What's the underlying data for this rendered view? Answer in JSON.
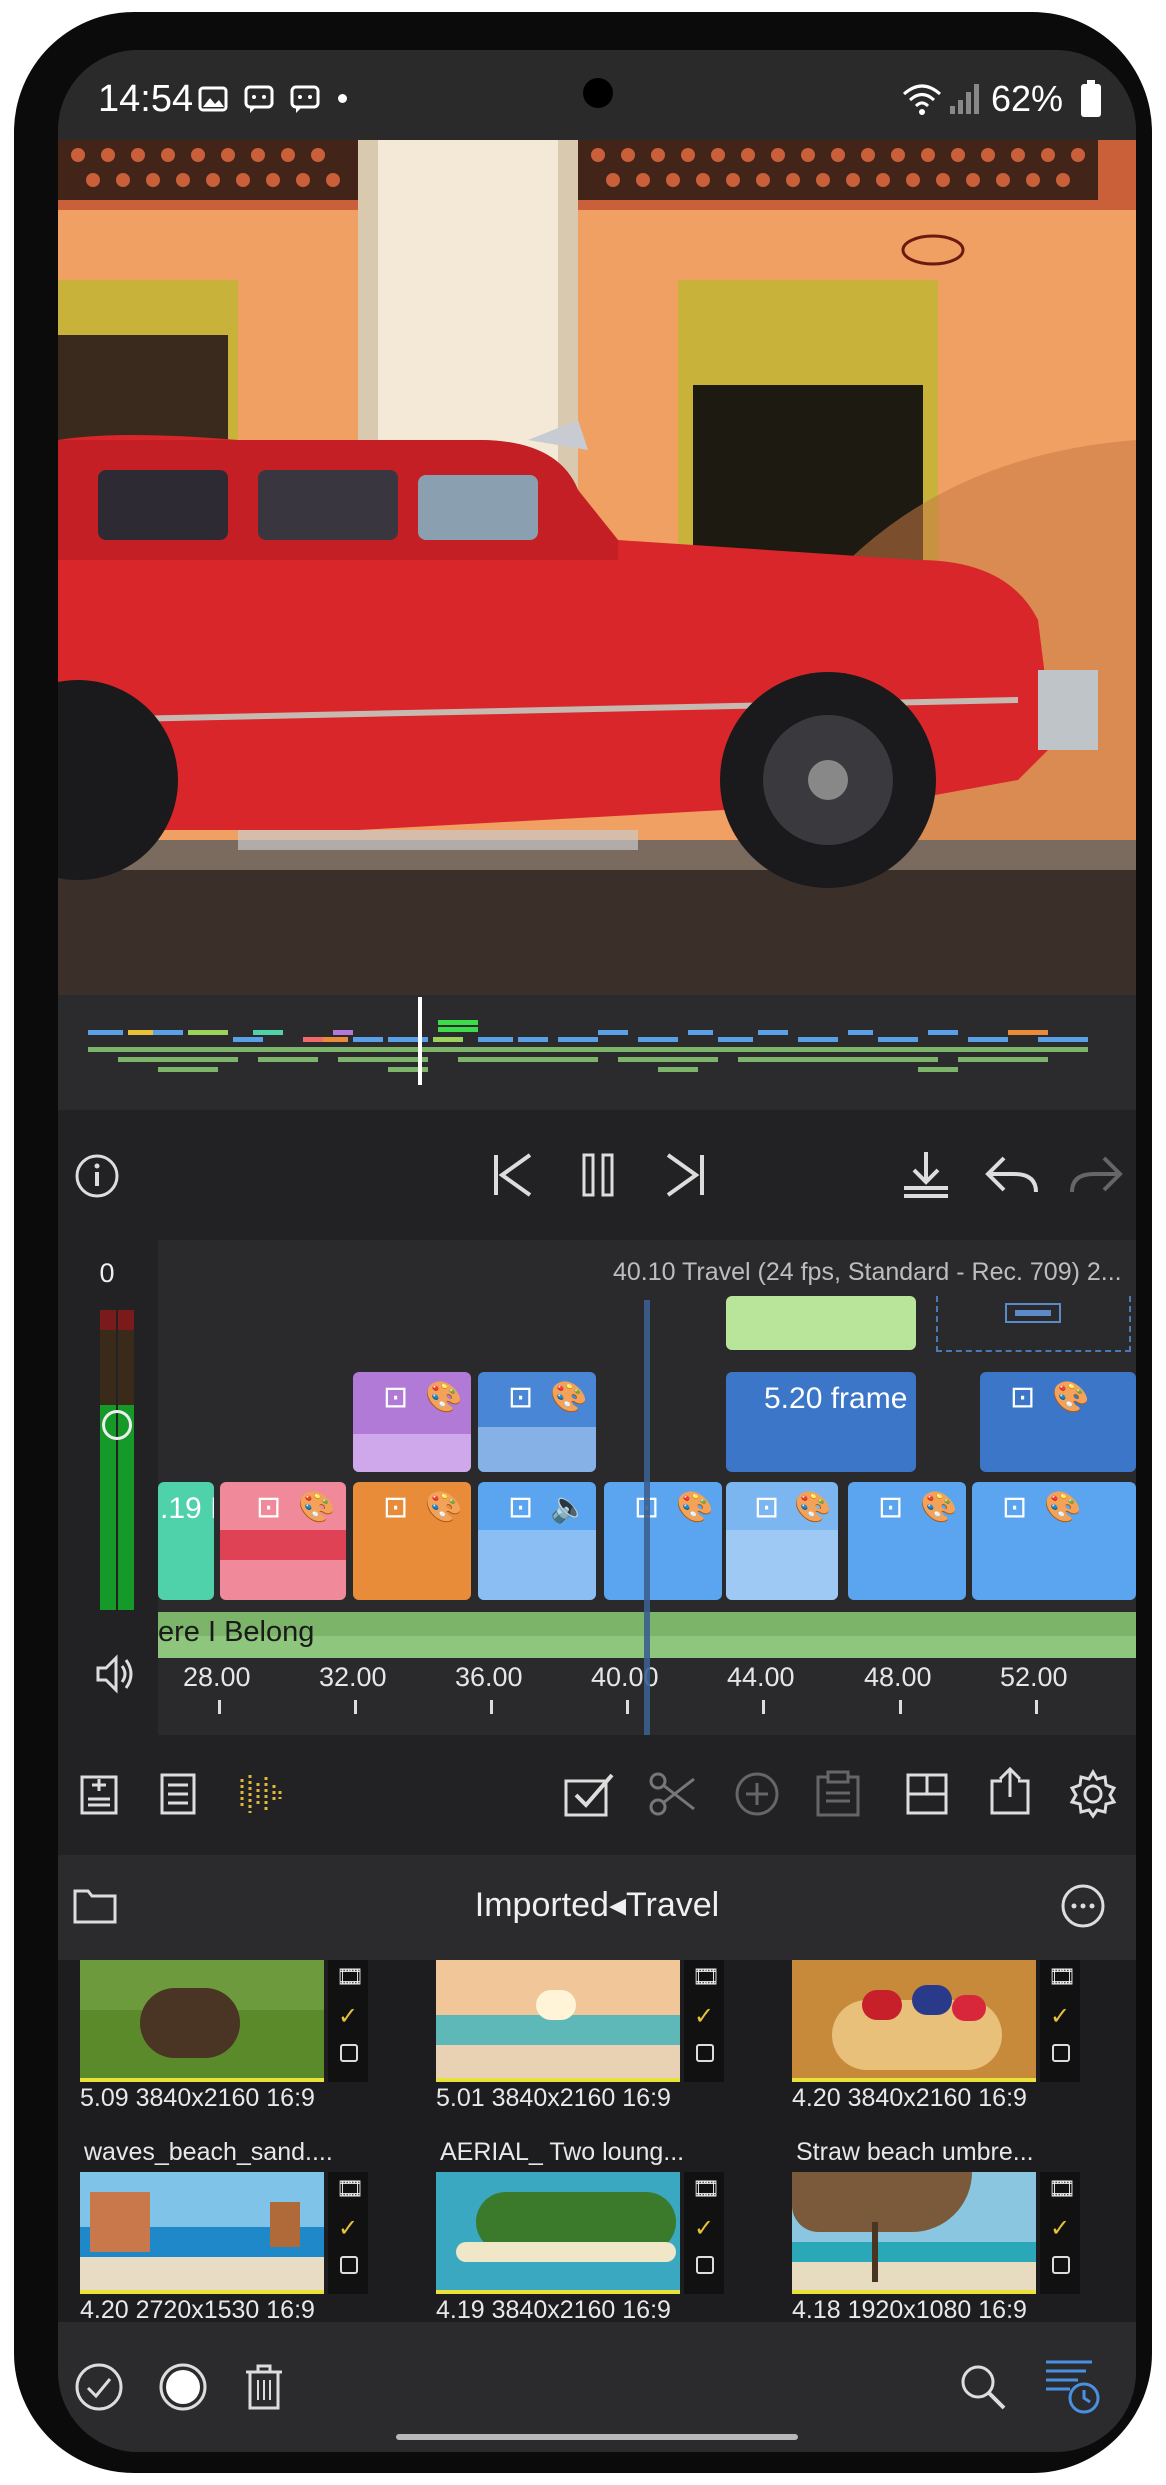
{
  "status": {
    "time": "14:54",
    "battery": "62%",
    "icons": [
      "image-icon",
      "message-icon",
      "message-icon",
      "dot-icon",
      "wifi-icon",
      "signal-icon",
      "battery-icon"
    ]
  },
  "transport": {
    "info_icon": "info-icon",
    "prev_icon": "skip-previous-icon",
    "pause_icon": "pause-icon",
    "next_icon": "skip-next-icon",
    "export_icon": "download-icon",
    "undo_icon": "undo-icon",
    "redo_icon": "redo-icon"
  },
  "timeline": {
    "meter_value": "0",
    "info": "40.10  Travel (24 fps, Standard - Rec. 709) 2...",
    "frame_label": "5.20 frame",
    "clip_start_label": ".19 I",
    "audio_label": "ere I Belong",
    "ruler": [
      "28.00",
      "32.00",
      "36.00",
      "40.00",
      "44.00",
      "48.00",
      "52.00"
    ]
  },
  "toolbar": {
    "icons": [
      "add-media-icon",
      "list-icon",
      "waveform-icon",
      "select-icon",
      "scissors-icon",
      "add-icon",
      "paste-icon",
      "layout-icon",
      "share-icon",
      "settings-icon"
    ]
  },
  "browser": {
    "title": "Imported◂Travel",
    "folder_icon": "folder-icon",
    "more_icon": "more-icon",
    "row1": [
      {
        "caption": "5.09 3840x2160 16:9"
      },
      {
        "caption": "5.01 3840x2160 16:9"
      },
      {
        "caption": "4.20 3840x2160 16:9"
      }
    ],
    "row2": [
      {
        "title": "waves_beach_sand....",
        "caption": "4.20 2720x1530 16:9"
      },
      {
        "title": "AERIAL_ Two loung...",
        "caption": "4.19 3840x2160 16:9"
      },
      {
        "title": "Straw beach umbre...",
        "caption": "4.18 1920x1080 16:9"
      }
    ]
  },
  "bottombar": {
    "icons": [
      "check-circle-icon",
      "record-icon",
      "trash-icon",
      "search-icon",
      "history-icon"
    ]
  },
  "colors": {
    "accent_blue": "#4a90e2",
    "clip_green": "#8bc46a",
    "clip_pink": "#f08a9a",
    "clip_orange": "#e88c3a",
    "clip_purple": "#b07ad6",
    "clip_teal": "#4fd1a9"
  }
}
